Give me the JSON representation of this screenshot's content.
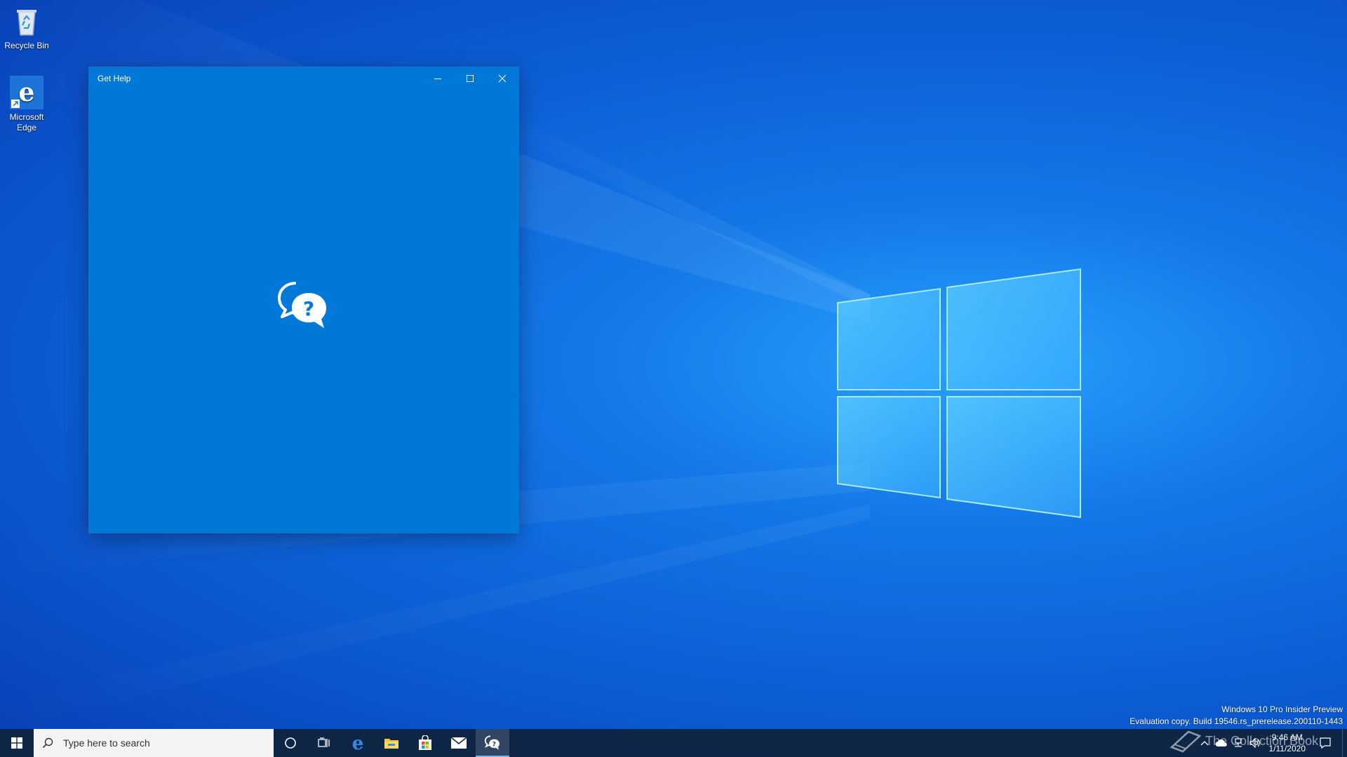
{
  "desktop": {
    "icons": [
      {
        "label": "Recycle Bin",
        "icon": "recycle-bin-icon"
      },
      {
        "label": "Microsoft Edge",
        "icon": "edge-icon"
      }
    ]
  },
  "window": {
    "title": "Get Help",
    "app_icon": "get-help-icon",
    "controls": {
      "minimize": "minimize-icon",
      "maximize": "maximize-icon",
      "close": "close-icon"
    },
    "background": "#0078d7"
  },
  "taskbar": {
    "search_placeholder": "Type here to search",
    "pinned": [
      "cortana-icon",
      "task-view-icon",
      "edge-icon",
      "file-explorer-icon",
      "store-icon",
      "mail-icon",
      "get-help-icon"
    ],
    "active_app": "Get Help",
    "clock": {
      "time": "9:46 AM",
      "date": "1/11/2020"
    }
  },
  "watermark": {
    "line1": "Windows 10 Pro Insider Preview",
    "line2": "Evaluation copy. Build 19546.rs_prerelease.200110-1443"
  },
  "overlay_watermark": "The Collection Book",
  "colors": {
    "accent": "#0078d7",
    "taskbar": "#102442",
    "active_indicator": "#76b9ed"
  }
}
